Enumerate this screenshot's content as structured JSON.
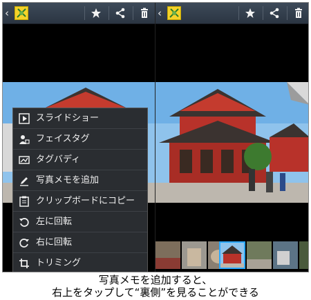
{
  "left_panel": {
    "actionbar": {
      "back_glyph": "‹",
      "icons": [
        "favorite-star-icon",
        "share-icon",
        "trash-icon"
      ]
    },
    "context_menu": {
      "items": [
        {
          "label": "スライドショー",
          "icon": "play-icon"
        },
        {
          "label": "フェイスタグ",
          "icon": "face-tag-icon"
        },
        {
          "label": "タグバディ",
          "icon": "tag-buddy-icon"
        },
        {
          "label": "写真メモを追加",
          "icon": "pencil-icon"
        },
        {
          "label": "クリップボードにコピー",
          "icon": "clipboard-icon"
        },
        {
          "label": "左に回転",
          "icon": "rotate-left-icon"
        },
        {
          "label": "右に回転",
          "icon": "rotate-right-icon"
        },
        {
          "label": "トリミング",
          "icon": "crop-icon"
        }
      ]
    }
  },
  "right_panel": {
    "actionbar": {
      "back_glyph": "‹",
      "icons": [
        "favorite-star-icon",
        "share-icon",
        "trash-icon"
      ]
    },
    "filmstrip": {
      "thumb_count": 6,
      "selected_index": 2
    }
  },
  "caption": {
    "line1": "写真メモを追加すると、",
    "line2": "右上をタップして“裏側”を見ることができる"
  },
  "colors": {
    "actionbar": "#35404d",
    "menu_bg": "#2a2d31",
    "sky": "#8fc3ec",
    "temple_red": "#b8322a",
    "selection": "#2aa8ff"
  }
}
